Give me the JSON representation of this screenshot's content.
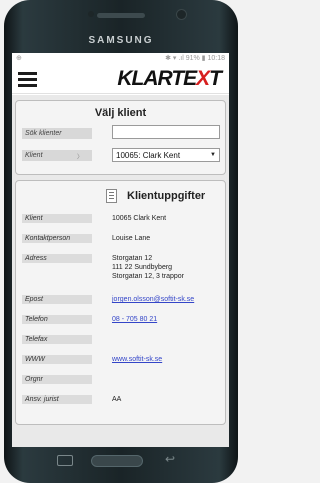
{
  "device": {
    "brand": "SAMSUNG"
  },
  "status": {
    "left": "⊕",
    "right": "✱ ▾ .ıl 91% ▮ 10:18"
  },
  "app": {
    "logo_main": "KLARTE",
    "logo_x": "X",
    "logo_end": "T"
  },
  "client_select": {
    "title": "Välj klient",
    "search_label": "Sök klienter",
    "search_value": "",
    "client_label": "Klient",
    "client_value": "10065: Clark Kent"
  },
  "client_info": {
    "title": "Klientuppgifter",
    "rows": [
      {
        "label": "Klient",
        "value": "10065 Clark Kent"
      },
      {
        "label": "Kontaktperson",
        "value": "Louise Lane"
      },
      {
        "label": "Adress",
        "value": "Storgatan 12\n111 22 Sundbyberg\nStorgatan 12, 3 trappor"
      },
      {
        "label": "Epost",
        "value": "jorgen.olsson@softit-sk.se"
      },
      {
        "label": "Telefon",
        "value": "08 - 705 80 21"
      },
      {
        "label": "Telefax",
        "value": ""
      },
      {
        "label": "WWW",
        "value": "www.softit-sk.se"
      },
      {
        "label": "Orgnr",
        "value": ""
      },
      {
        "label": "Ansv. jurist",
        "value": "AA"
      }
    ]
  },
  "colors": {
    "accent": "#d71f1f",
    "link": "#3345c8"
  }
}
